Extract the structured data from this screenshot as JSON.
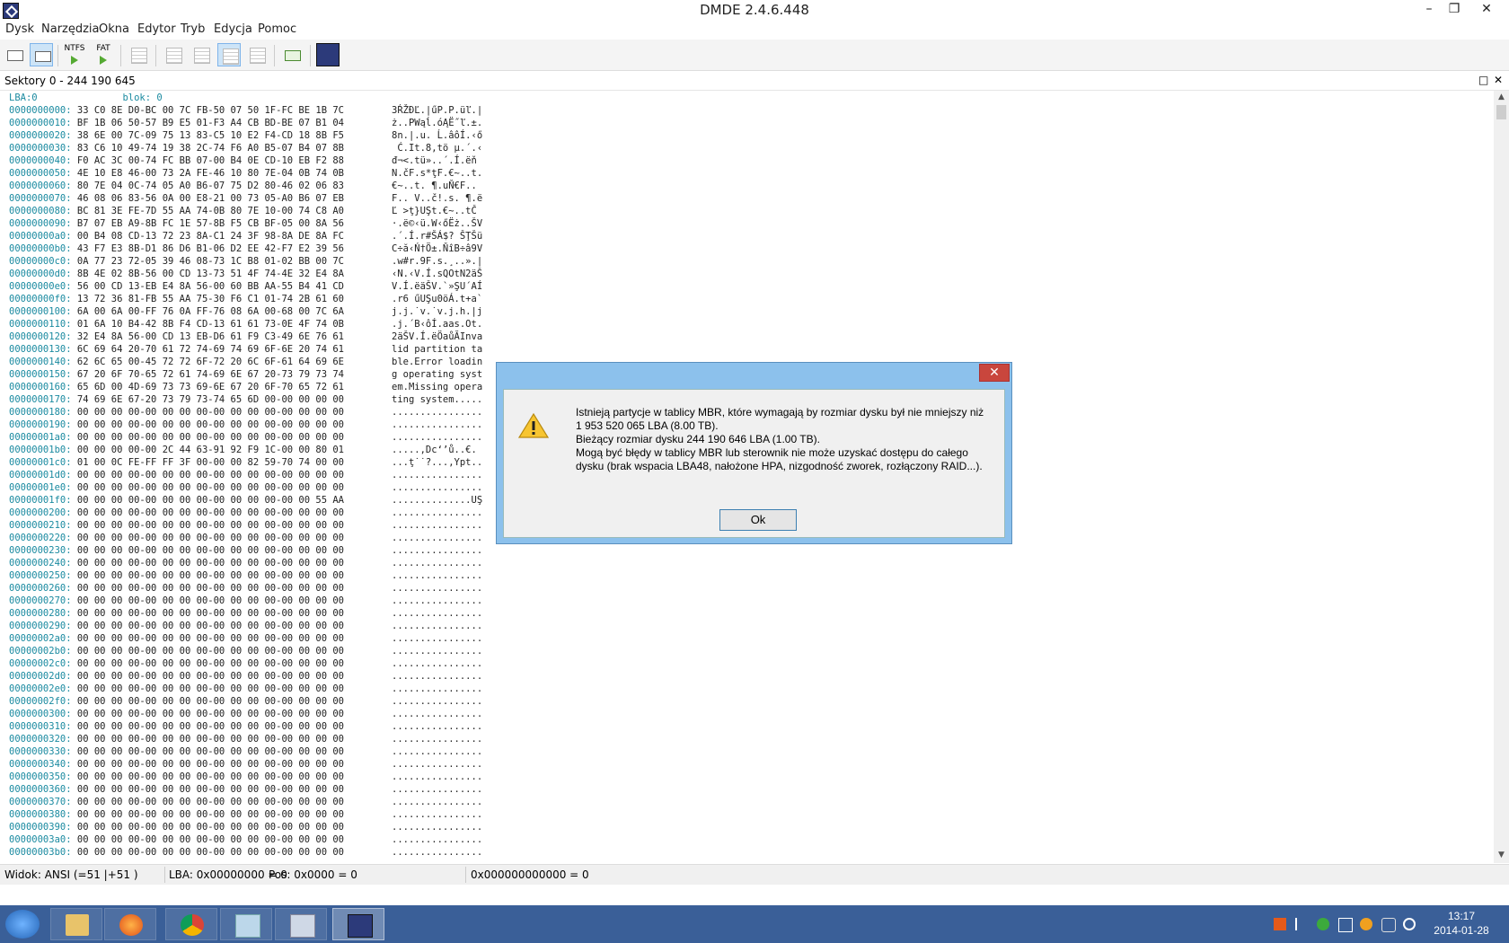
{
  "window": {
    "title": "DMDE 2.4.6.448",
    "minimize": "–",
    "restore": "❐",
    "close": "✕"
  },
  "menu": [
    "Dysk",
    "Narzędzia",
    "Okna",
    "Edytor",
    "Tryb",
    "Edycja",
    "Pomoc"
  ],
  "toolbar": {
    "ntfs_label": "NTFS",
    "fat_label": "FAT"
  },
  "panel": {
    "title": "Sektory 0 - 244 190 645",
    "maximize": "□",
    "close": "✕"
  },
  "hex": {
    "lba_label": "LBA:0",
    "block_label": "blok: 0",
    "rows": [
      {
        "off": "0000000000:",
        "hex": "33 C0 8E D0-BC 00 7C FB-50 07 50 1F-FC BE 1B 7C",
        "ascii": "3ŔŽĐĽ.|űP.P.üľ.|"
      },
      {
        "off": "0000000010:",
        "hex": "BF 1B 06 50-57 B9 E5 01-F3 A4 CB BD-BE 07 B1 04",
        "ascii": "ż..PWąĺ.óĄË˝ľ.±."
      },
      {
        "off": "0000000020:",
        "hex": "38 6E 00 7C-09 75 13 83-C5 10 E2 F4-CD 18 8B F5",
        "ascii": "8n.|.u. Ĺ.âôÍ.‹ő"
      },
      {
        "off": "0000000030:",
        "hex": "83 C6 10 49-74 19 38 2C-74 F6 A0 B5-07 B4 07 8B",
        "ascii": " Ć.It.8,tö µ.´.‹"
      },
      {
        "off": "0000000040:",
        "hex": "F0 AC 3C 00-74 FC BB 07-00 B4 0E CD-10 EB F2 88",
        "ascii": "đ¬<.tü»..´.Í.ëň "
      },
      {
        "off": "0000000050:",
        "hex": "4E 10 E8 46-00 73 2A FE-46 10 80 7E-04 0B 74 0B",
        "ascii": "N.čF.s*ţF.€~..t."
      },
      {
        "off": "0000000060:",
        "hex": "80 7E 04 0C-74 05 A0 B6-07 75 D2 80-46 02 06 83",
        "ascii": "€~..t. ¶.uŇ€F.. "
      },
      {
        "off": "0000000070:",
        "hex": "46 08 06 83-56 0A 00 E8-21 00 73 05-A0 B6 07 EB",
        "ascii": "F.. V..č!.s. ¶.ë"
      },
      {
        "off": "0000000080:",
        "hex": "BC 81 3E FE-7D 55 AA 74-0B 80 7E 10-00 74 C8 A0",
        "ascii": "Ľ >ţ}UŞt.€~..tČ "
      },
      {
        "off": "0000000090:",
        "hex": "B7 07 EB A9-8B FC 1E 57-8B F5 CB BF-05 00 8A 56",
        "ascii": "·.ë©‹ü.W‹őËż..ŠV"
      },
      {
        "off": "00000000a0:",
        "hex": "00 B4 08 CD-13 72 23 8A-C1 24 3F 98-8A DE 8A FC",
        "ascii": ".´.Í.r#ŠÁ$? ŠŢŠü"
      },
      {
        "off": "00000000b0:",
        "hex": "43 F7 E3 8B-D1 86 D6 B1-06 D2 EE 42-F7 E2 39 56",
        "ascii": "C÷ă‹Ń†Ö±.ŇîB÷â9V"
      },
      {
        "off": "00000000c0:",
        "hex": "0A 77 23 72-05 39 46 08-73 1C B8 01-02 BB 00 7C",
        "ascii": ".w#r.9F.s.¸..».|"
      },
      {
        "off": "00000000d0:",
        "hex": "8B 4E 02 8B-56 00 CD 13-73 51 4F 74-4E 32 E4 8A",
        "ascii": "‹N.‹V.Í.sQOtN2äŠ"
      },
      {
        "off": "00000000e0:",
        "hex": "56 00 CD 13-EB E4 8A 56-00 60 BB AA-55 B4 41 CD",
        "ascii": "V.Í.ëäŠV.`»ŞU´AÍ"
      },
      {
        "off": "00000000f0:",
        "hex": "13 72 36 81-FB 55 AA 75-30 F6 C1 01-74 2B 61 60",
        "ascii": ".r6 űUŞu0öÁ.t+a`"
      },
      {
        "off": "0000000100:",
        "hex": "6A 00 6A 00-FF 76 0A FF-76 08 6A 00-68 00 7C 6A",
        "ascii": "j.j.˙v.˙v.j.h.|j"
      },
      {
        "off": "0000000110:",
        "hex": "01 6A 10 B4-42 8B F4 CD-13 61 61 73-0E 4F 74 0B",
        "ascii": ".j.´B‹ôÍ.aas.Ot."
      },
      {
        "off": "0000000120:",
        "hex": "32 E4 8A 56-00 CD 13 EB-D6 61 F9 C3-49 6E 76 61",
        "ascii": "2äŠV.Í.ëÖaůĂInva"
      },
      {
        "off": "0000000130:",
        "hex": "6C 69 64 20-70 61 72 74-69 74 69 6F-6E 20 74 61",
        "ascii": "lid partition ta"
      },
      {
        "off": "0000000140:",
        "hex": "62 6C 65 00-45 72 72 6F-72 20 6C 6F-61 64 69 6E",
        "ascii": "ble.Error loadin"
      },
      {
        "off": "0000000150:",
        "hex": "67 20 6F 70-65 72 61 74-69 6E 67 20-73 79 73 74",
        "ascii": "g operating syst"
      },
      {
        "off": "0000000160:",
        "hex": "65 6D 00 4D-69 73 73 69-6E 67 20 6F-70 65 72 61",
        "ascii": "em.Missing opera"
      },
      {
        "off": "0000000170:",
        "hex": "74 69 6E 67-20 73 79 73-74 65 6D 00-00 00 00 00",
        "ascii": "ting system....."
      },
      {
        "off": "0000000180:",
        "hex": "00 00 00 00-00 00 00 00-00 00 00 00-00 00 00 00",
        "ascii": "................"
      },
      {
        "off": "0000000190:",
        "hex": "00 00 00 00-00 00 00 00-00 00 00 00-00 00 00 00",
        "ascii": "................"
      },
      {
        "off": "00000001a0:",
        "hex": "00 00 00 00-00 00 00 00-00 00 00 00-00 00 00 00",
        "ascii": "................"
      },
      {
        "off": "00000001b0:",
        "hex": "00 00 00 00-00 2C 44 63-91 92 F9 1C-00 00 80 01",
        "ascii": ".....,Dc‘’ů..€."
      },
      {
        "off": "00000001c0:",
        "hex": "01 00 0C FE-FF FF 3F 00-00 00 82 59-70 74 00 00",
        "ascii": "...ţ˙˙?...‚Ypt.."
      },
      {
        "off": "00000001d0:",
        "hex": "00 00 00 00-00 00 00 00-00 00 00 00-00 00 00 00",
        "ascii": "................"
      },
      {
        "off": "00000001e0:",
        "hex": "00 00 00 00-00 00 00 00-00 00 00 00-00 00 00 00",
        "ascii": "................"
      },
      {
        "off": "00000001f0:",
        "hex": "00 00 00 00-00 00 00 00-00 00 00 00-00 00 55 AA",
        "ascii": "..............UŞ"
      },
      {
        "off": "0000000200:",
        "hex": "00 00 00 00-00 00 00 00-00 00 00 00-00 00 00 00",
        "ascii": "................"
      },
      {
        "off": "0000000210:",
        "hex": "00 00 00 00-00 00 00 00-00 00 00 00-00 00 00 00",
        "ascii": "................"
      },
      {
        "off": "0000000220:",
        "hex": "00 00 00 00-00 00 00 00-00 00 00 00-00 00 00 00",
        "ascii": "................"
      },
      {
        "off": "0000000230:",
        "hex": "00 00 00 00-00 00 00 00-00 00 00 00-00 00 00 00",
        "ascii": "................"
      },
      {
        "off": "0000000240:",
        "hex": "00 00 00 00-00 00 00 00-00 00 00 00-00 00 00 00",
        "ascii": "................"
      },
      {
        "off": "0000000250:",
        "hex": "00 00 00 00-00 00 00 00-00 00 00 00-00 00 00 00",
        "ascii": "................"
      },
      {
        "off": "0000000260:",
        "hex": "00 00 00 00-00 00 00 00-00 00 00 00-00 00 00 00",
        "ascii": "................"
      },
      {
        "off": "0000000270:",
        "hex": "00 00 00 00-00 00 00 00-00 00 00 00-00 00 00 00",
        "ascii": "................"
      },
      {
        "off": "0000000280:",
        "hex": "00 00 00 00-00 00 00 00-00 00 00 00-00 00 00 00",
        "ascii": "................"
      },
      {
        "off": "0000000290:",
        "hex": "00 00 00 00-00 00 00 00-00 00 00 00-00 00 00 00",
        "ascii": "................"
      },
      {
        "off": "00000002a0:",
        "hex": "00 00 00 00-00 00 00 00-00 00 00 00-00 00 00 00",
        "ascii": "................"
      },
      {
        "off": "00000002b0:",
        "hex": "00 00 00 00-00 00 00 00-00 00 00 00-00 00 00 00",
        "ascii": "................"
      },
      {
        "off": "00000002c0:",
        "hex": "00 00 00 00-00 00 00 00-00 00 00 00-00 00 00 00",
        "ascii": "................"
      },
      {
        "off": "00000002d0:",
        "hex": "00 00 00 00-00 00 00 00-00 00 00 00-00 00 00 00",
        "ascii": "................"
      },
      {
        "off": "00000002e0:",
        "hex": "00 00 00 00-00 00 00 00-00 00 00 00-00 00 00 00",
        "ascii": "................"
      },
      {
        "off": "00000002f0:",
        "hex": "00 00 00 00-00 00 00 00-00 00 00 00-00 00 00 00",
        "ascii": "................"
      },
      {
        "off": "0000000300:",
        "hex": "00 00 00 00-00 00 00 00-00 00 00 00-00 00 00 00",
        "ascii": "................"
      },
      {
        "off": "0000000310:",
        "hex": "00 00 00 00-00 00 00 00-00 00 00 00-00 00 00 00",
        "ascii": "................"
      },
      {
        "off": "0000000320:",
        "hex": "00 00 00 00-00 00 00 00-00 00 00 00-00 00 00 00",
        "ascii": "................"
      },
      {
        "off": "0000000330:",
        "hex": "00 00 00 00-00 00 00 00-00 00 00 00-00 00 00 00",
        "ascii": "................"
      },
      {
        "off": "0000000340:",
        "hex": "00 00 00 00-00 00 00 00-00 00 00 00-00 00 00 00",
        "ascii": "................"
      },
      {
        "off": "0000000350:",
        "hex": "00 00 00 00-00 00 00 00-00 00 00 00-00 00 00 00",
        "ascii": "................"
      },
      {
        "off": "0000000360:",
        "hex": "00 00 00 00-00 00 00 00-00 00 00 00-00 00 00 00",
        "ascii": "................"
      },
      {
        "off": "0000000370:",
        "hex": "00 00 00 00-00 00 00 00-00 00 00 00-00 00 00 00",
        "ascii": "................"
      },
      {
        "off": "0000000380:",
        "hex": "00 00 00 00-00 00 00 00-00 00 00 00-00 00 00 00",
        "ascii": "................"
      },
      {
        "off": "0000000390:",
        "hex": "00 00 00 00-00 00 00 00-00 00 00 00-00 00 00 00",
        "ascii": "................"
      },
      {
        "off": "00000003a0:",
        "hex": "00 00 00 00-00 00 00 00-00 00 00 00-00 00 00 00",
        "ascii": "................"
      },
      {
        "off": "00000003b0:",
        "hex": "00 00 00 00-00 00 00 00-00 00 00 00-00 00 00 00",
        "ascii": "................"
      }
    ]
  },
  "status": {
    "view": "Widok: ANSI (=51 |+51 )",
    "lba": "LBA: 0x00000000 = 0",
    "pos": "Pos: 0x0000 = 0",
    "value": "0x000000000000 = 0"
  },
  "dialog": {
    "close": "✕",
    "icon": "warning-icon",
    "lines": [
      "Istnieją partycje w tablicy MBR, które wymagają by rozmiar dysku był nie mniejszy niż",
      "1 953 520 065 LBA (8.00 TB).",
      "Bieżący rozmiar dysku 244 190 646 LBA (1.00 TB).",
      "Mogą być błędy w tablicy MBR lub sterownik nie może uzyskać dostępu do całego",
      "dysku (brak wspacia LBA48, nałożone HPA, nizgodność zworek, rozłączony RAID...)."
    ],
    "ok_label": "Ok"
  },
  "taskbar": {
    "items": [
      "start-button",
      "file-explorer",
      "firefox",
      "chrome",
      "notepad",
      "control-panel",
      "dmde"
    ],
    "active": "dmde",
    "clock_time": "13:17",
    "clock_date": "2014-01-28"
  },
  "colors": {
    "offset": "#1a8aa0",
    "dialog_frame": "#8cc1ec",
    "close_red": "#c9463d",
    "taskbar": "#3a5f98"
  }
}
